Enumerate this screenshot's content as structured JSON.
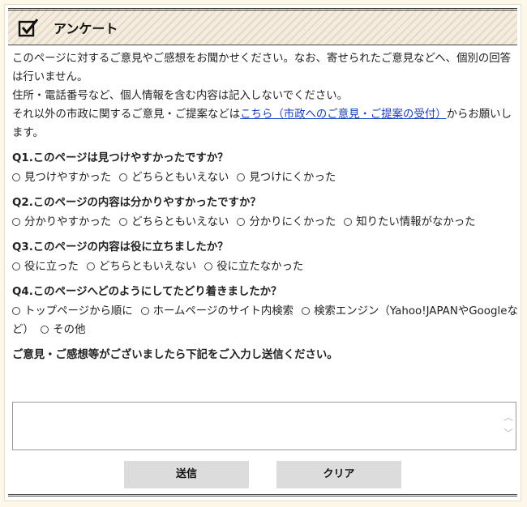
{
  "header": {
    "title": "アンケート",
    "icon": "checkbox-icon"
  },
  "intro": {
    "line1": "このページに対するご意見やご感想をお聞かせください。なお、寄せられたご意見などへ、個別の回答は行いません。",
    "line2": "住所・電話番号など、個人情報を含む内容は記入しないでください。",
    "line3_pre": "それ以外の市政に関するご意見・ご提案などは",
    "line3_link": "こちら（市政へのご意見・ご提案の受付）",
    "line3_post": "からお願いします。"
  },
  "questions": [
    {
      "label": "Q1.このページは見つけやすかったですか？",
      "options": [
        "見つけやすかった",
        "どちらともいえない",
        "見つけにくかった"
      ]
    },
    {
      "label": "Q2.このページの内容は分かりやすかったですか？",
      "options": [
        "分かりやすかった",
        "どちらともいえない",
        "分かりにくかった",
        "知りたい情報がなかった"
      ]
    },
    {
      "label": "Q3.このページの内容は役に立ちましたか？",
      "options": [
        "役に立った",
        "どちらともいえない",
        "役に立たなかった"
      ]
    },
    {
      "label": "Q4.このページへどのようにしてたどり着きましたか？",
      "options": [
        "トップページから順に",
        "ホームページのサイト内検索",
        "検索エンジン（Yahoo!JAPANやGoogleなど）",
        "その他"
      ]
    }
  ],
  "feedback": {
    "label": "ご意見・ご感想等がございましたら下記をご入力し送信ください。",
    "value": ""
  },
  "buttons": {
    "submit": "送信",
    "clear": "クリア"
  }
}
